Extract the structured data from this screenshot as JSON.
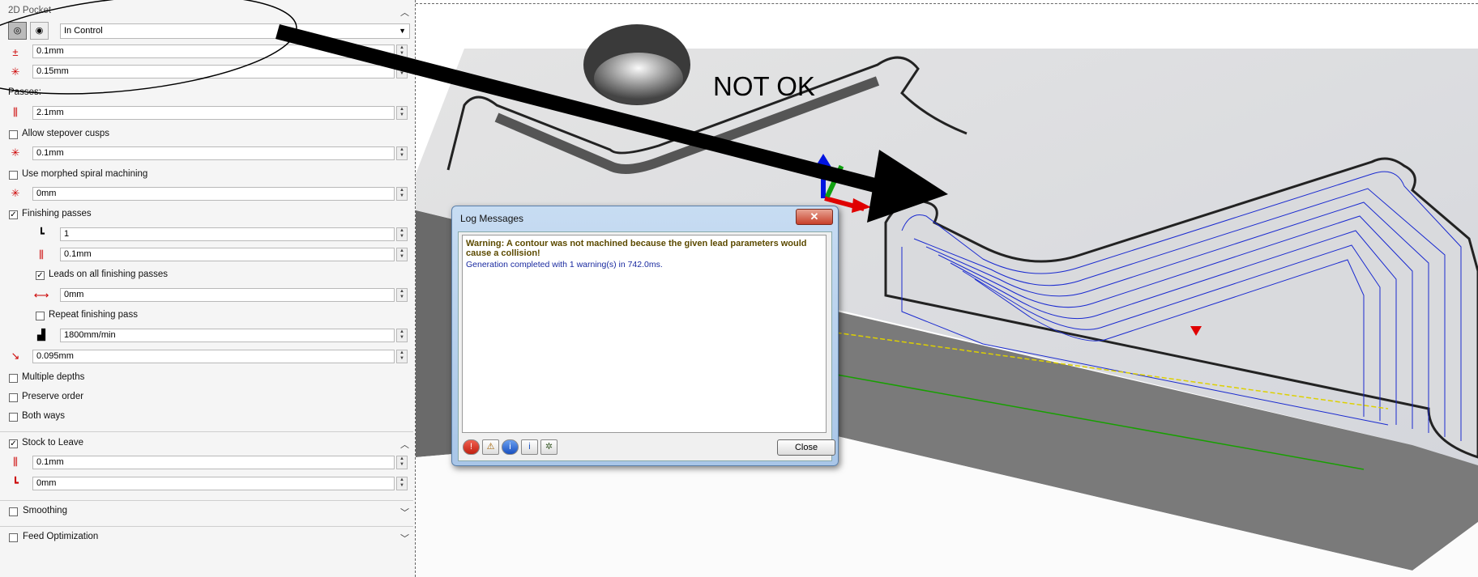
{
  "panel": {
    "section_title": "2D Pocket",
    "control_select": "In Control",
    "tolerance": "0.1mm",
    "stepover_small": "0.15mm",
    "passes_label": "Passes:",
    "passes_value": "2.1mm",
    "allow_stepover_cusps_label": "Allow stepover cusps",
    "cusps_value": "0.1mm",
    "morphed_spiral_label": "Use morphed spiral machining",
    "morphed_value": "0mm",
    "finishing_passes_label": "Finishing passes",
    "finishing_count": "1",
    "finishing_stepover": "0.1mm",
    "leads_all_label": "Leads on all finishing passes",
    "leads_value": "0mm",
    "repeat_finishing_label": "Repeat finishing pass",
    "feedrate": "1800mm/min",
    "tool_value": "0.095mm",
    "multiple_depths_label": "Multiple depths",
    "preserve_order_label": "Preserve order",
    "both_ways_label": "Both ways",
    "stock_to_leave_label": "Stock to Leave",
    "stock_radial": "0.1mm",
    "stock_axial": "0mm",
    "smoothing_label": "Smoothing",
    "feed_optimization_label": "Feed Optimization"
  },
  "dialog": {
    "title": "Log Messages",
    "close_x": "✕",
    "warning": "Warning: A contour was not machined because the given lead parameters would cause a collision!",
    "info": "Generation completed with 1 warning(s) in 742.0ms.",
    "close_button": "Close"
  },
  "annotation": "NOT OK",
  "checks": {
    "finishing_passes": true,
    "leads_all": true,
    "stock_to_leave": true
  }
}
